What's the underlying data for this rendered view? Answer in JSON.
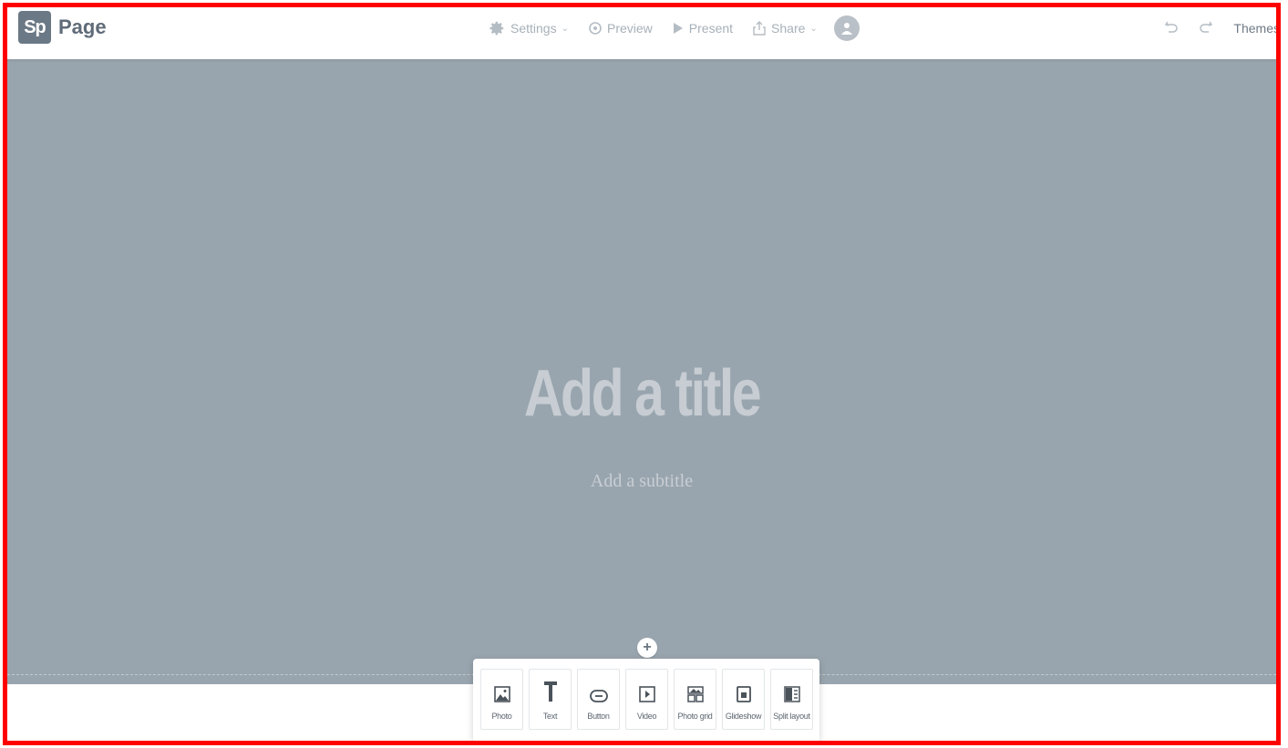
{
  "app": {
    "logo_badge": "Sp",
    "logo_text": "Page"
  },
  "toolbar": {
    "settings_label": "Settings",
    "preview_label": "Preview",
    "present_label": "Present",
    "share_label": "Share",
    "themes_label": "Themes"
  },
  "hero": {
    "title_placeholder": "Add a title",
    "subtitle_placeholder": "Add a subtitle"
  },
  "picker": {
    "add_symbol": "+",
    "items": [
      {
        "label": "Photo",
        "icon": "photo-icon"
      },
      {
        "label": "Text",
        "icon": "text-icon"
      },
      {
        "label": "Button",
        "icon": "button-icon"
      },
      {
        "label": "Video",
        "icon": "video-icon"
      },
      {
        "label": "Photo grid",
        "icon": "photo-grid-icon"
      },
      {
        "label": "Glideshow",
        "icon": "glideshow-icon"
      },
      {
        "label": "Split layout",
        "icon": "split-layout-icon"
      }
    ]
  },
  "colors": {
    "hero_bg": "#99a5ae",
    "frame_border": "#ff0000",
    "logo_badge": "#6b7885"
  }
}
